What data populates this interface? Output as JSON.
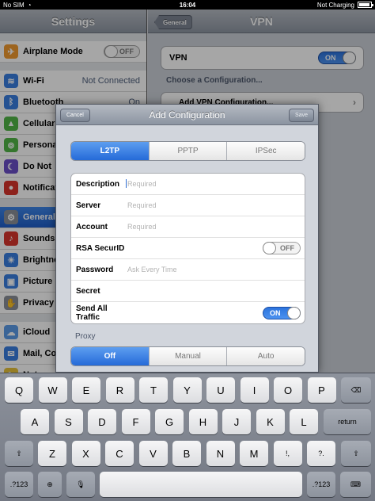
{
  "statusbar": {
    "carrier": "No SIM",
    "time": "16:04",
    "battery_text": "Not Charging",
    "battery_level": 0.9
  },
  "master": {
    "title": "Settings",
    "items": [
      {
        "label": "Airplane Mode",
        "value": "OFF",
        "kind": "switch",
        "icon": "airplane-icon",
        "color": "#f29a2e",
        "glyph": "✈"
      },
      {
        "label": "Wi-Fi",
        "value": "Not Connected",
        "kind": "value",
        "icon": "wifi-icon",
        "color": "#3a7ee0",
        "glyph": "≋"
      },
      {
        "label": "Bluetooth",
        "value": "On",
        "kind": "value",
        "icon": "bluetooth-icon",
        "color": "#3a7ee0",
        "glyph": "ᛒ"
      },
      {
        "label": "Cellular",
        "value": "",
        "kind": "value",
        "icon": "cellular-icon",
        "color": "#52b548",
        "glyph": "▲"
      },
      {
        "label": "Personal",
        "value": "",
        "kind": "value",
        "icon": "hotspot-icon",
        "color": "#52b548",
        "glyph": "⊚"
      },
      {
        "label": "Do Not",
        "value": "",
        "kind": "value",
        "icon": "moon-icon",
        "color": "#6b4fc8",
        "glyph": "☾"
      },
      {
        "label": "Notifications",
        "value": "",
        "kind": "value",
        "icon": "notifications-icon",
        "color": "#d9352c",
        "glyph": "●"
      },
      {
        "label": "General",
        "value": "",
        "kind": "value",
        "icon": "gear-icon",
        "color": "#8a8f98",
        "glyph": "⚙",
        "selected": true
      },
      {
        "label": "Sounds",
        "value": "",
        "kind": "value",
        "icon": "speaker-icon",
        "color": "#d9352c",
        "glyph": "♪"
      },
      {
        "label": "Brightness",
        "value": "",
        "kind": "value",
        "icon": "brightness-icon",
        "color": "#3a7ee0",
        "glyph": "☀"
      },
      {
        "label": "Picture",
        "value": "",
        "kind": "value",
        "icon": "picture-frame-icon",
        "color": "#3a7ee0",
        "glyph": "▣"
      },
      {
        "label": "Privacy",
        "value": "",
        "kind": "value",
        "icon": "hand-icon",
        "color": "#8a8f98",
        "glyph": "✋"
      },
      {
        "label": "iCloud",
        "value": "",
        "kind": "value",
        "icon": "cloud-icon",
        "color": "#5b9be8",
        "glyph": "☁"
      },
      {
        "label": "Mail, Cont",
        "value": "",
        "kind": "value",
        "icon": "mail-icon",
        "color": "#3a7ee0",
        "glyph": "✉"
      },
      {
        "label": "Notes",
        "value": "",
        "kind": "value",
        "icon": "notes-icon",
        "color": "#e6c23a",
        "glyph": "✎"
      }
    ]
  },
  "detail": {
    "title": "VPN",
    "back_label": "General",
    "vpn_label": "VPN",
    "vpn_switch": "ON",
    "choose_label": "Choose a Configuration...",
    "add_vpn_label": "Add VPN Configuration..."
  },
  "sheet": {
    "title": "Add Configuration",
    "cancel_label": "Cancel",
    "save_label": "Save",
    "protocols": [
      "L2TP",
      "PPTP",
      "IPSec"
    ],
    "active_protocol": 0,
    "fields": [
      {
        "label": "Description",
        "placeholder": "Required",
        "kind": "text",
        "focused": true
      },
      {
        "label": "Server",
        "placeholder": "Required",
        "kind": "text"
      },
      {
        "label": "Account",
        "placeholder": "Required",
        "kind": "text"
      },
      {
        "label": "RSA SecurID",
        "value": "OFF",
        "kind": "switch-off"
      },
      {
        "label": "Password",
        "placeholder": "Ask Every Time",
        "kind": "text"
      },
      {
        "label": "Secret",
        "placeholder": "",
        "kind": "text"
      },
      {
        "label": "Send All Traffic",
        "value": "ON",
        "kind": "switch-on"
      }
    ],
    "proxy_label": "Proxy",
    "proxy_options": [
      "Off",
      "Manual",
      "Auto"
    ],
    "active_proxy": 0
  },
  "keyboard": {
    "row1": [
      "Q",
      "W",
      "E",
      "R",
      "T",
      "Y",
      "U",
      "I",
      "O",
      "P"
    ],
    "row2": [
      "A",
      "S",
      "D",
      "F",
      "G",
      "H",
      "J",
      "K",
      "L"
    ],
    "row3": [
      "Z",
      "X",
      "C",
      "V",
      "B",
      "N",
      "M",
      "!,",
      "?."
    ],
    "return_label": "return",
    "numbers_label": ".?123",
    "backspace_icon": "backspace-icon",
    "shift_icon": "shift-icon",
    "globe_icon": "globe-icon",
    "mic_icon": "microphone-icon",
    "hide_icon": "keyboard-hide-icon"
  }
}
